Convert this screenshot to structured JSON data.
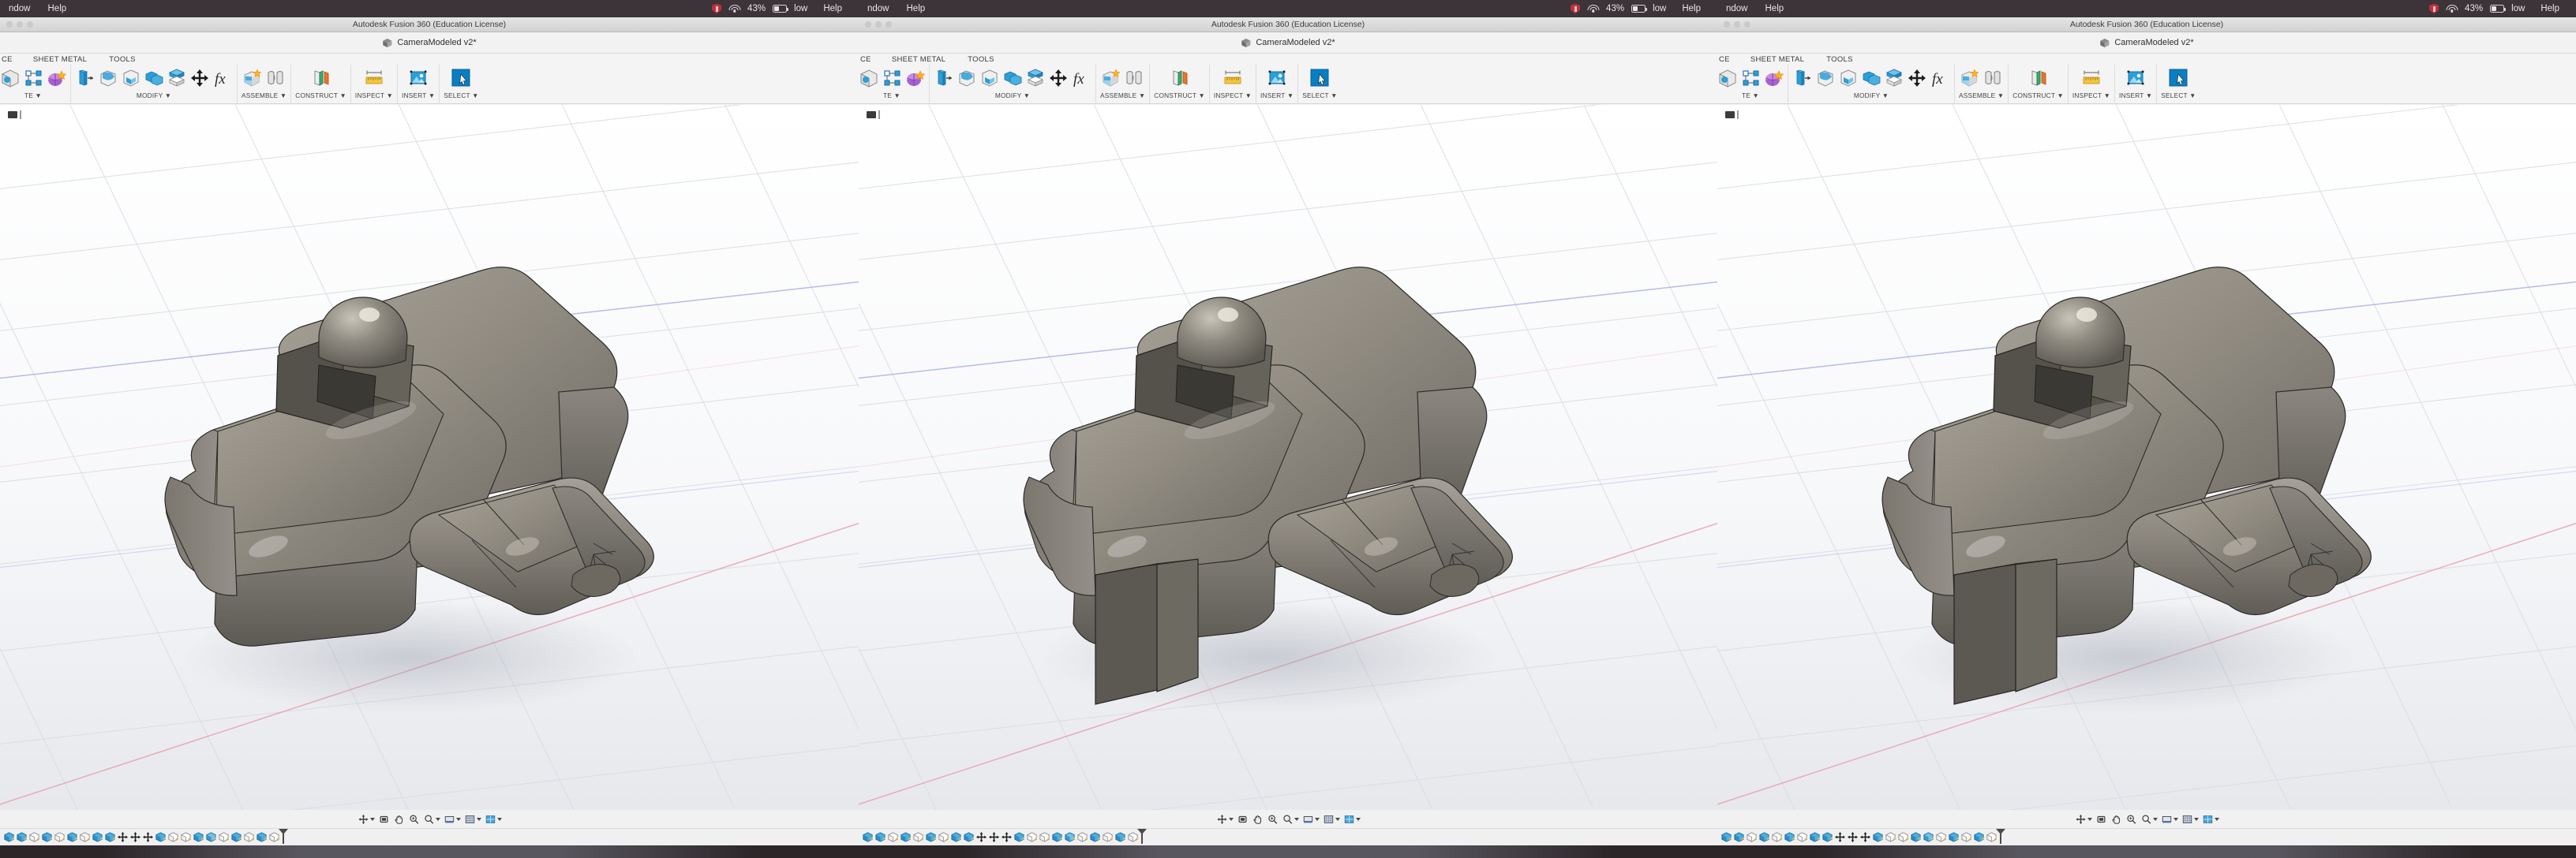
{
  "app": {
    "window_title": "Autodesk Fusion 360 (Education License)",
    "document_tab": "CameraModeled v2*"
  },
  "macbar": {
    "menus": [
      "ndow",
      "Help"
    ],
    "menus_full": [
      "Window",
      "Help"
    ],
    "battery_percent": "43%",
    "battery_state": "low",
    "help_label": "Help"
  },
  "ribbon": {
    "tabs": [
      "CE",
      "SHEET METAL",
      "TOOLS"
    ],
    "tabs_right": [
      "SHEET METAL",
      "TOOLS"
    ],
    "panels": [
      {
        "label": "TE ▼",
        "name": "create"
      },
      {
        "label": "MODIFY ▼",
        "name": "modify"
      },
      {
        "label": "ASSEMBLE ▼",
        "name": "assemble"
      },
      {
        "label": "CONSTRUCT ▼",
        "name": "construct"
      },
      {
        "label": "INSPECT ▼",
        "name": "inspect"
      },
      {
        "label": "INSERT ▼",
        "name": "insert"
      },
      {
        "label": "SELECT ▼",
        "name": "select"
      }
    ],
    "panel_labels_right": [
      "▼",
      "MODIFY ▼",
      "ASSEMBLE ▼",
      "CONSTRUCT ▼",
      "INSPECT ▼",
      "INSERT ▼",
      "SELECT ▼"
    ]
  },
  "viewport": {
    "browser_toggle": "browser-panel-toggle",
    "model_name": "camera-body-model",
    "accent_axis_x": "#e08f9e",
    "accent_axis_y": "#8f9ee0",
    "material_color": "#7e7a72"
  },
  "navbar": {
    "items": [
      "orbit",
      "pan",
      "zoom",
      "zoom-fit",
      "display-settings",
      "grid-snaps",
      "viewports"
    ]
  },
  "timeline": {
    "feature_count": 22,
    "playhead_position": "end"
  },
  "windows": [
    {
      "id": "win-left",
      "title": "Autodesk Fusion 360 (Education License)",
      "tab": "CameraModeled v2*",
      "variant": "no-grip"
    },
    {
      "id": "win-center",
      "title": "Autodesk Fusion 360 (Education License)",
      "tab": "CameraModeled v2*",
      "variant": "grip"
    },
    {
      "id": "win-right",
      "title": "Autodesk Fusion 360 (Education License)",
      "tab": "CameraModeled v2*",
      "variant": "grip"
    }
  ]
}
